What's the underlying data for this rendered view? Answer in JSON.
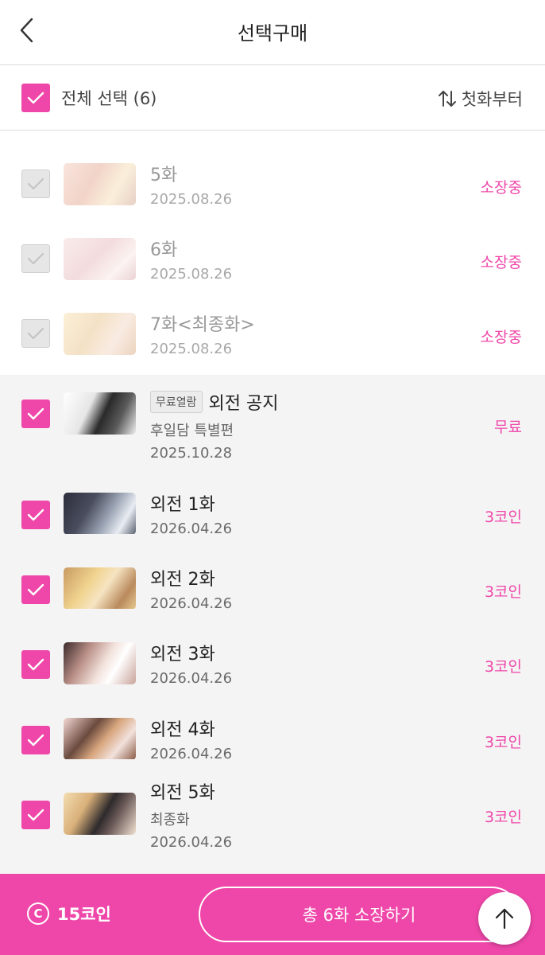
{
  "header": {
    "title": "선택구매"
  },
  "selectbar": {
    "select_all_label": "전체 선택 (6)",
    "sort_label": "첫화부터"
  },
  "episodes": [
    {
      "title": "5화",
      "date": "2025.08.26",
      "status": "소장중"
    },
    {
      "title": "6화",
      "date": "2025.08.26",
      "status": "소장중"
    },
    {
      "title": "7화<최종화>",
      "date": "2025.08.26",
      "status": "소장중"
    },
    {
      "badge": "무료열람",
      "title": "외전 공지",
      "subtitle": "후일담 특별편",
      "date": "2025.10.28",
      "status": "무료"
    },
    {
      "title": "외전 1화",
      "date": "2026.04.26",
      "status": "3코인"
    },
    {
      "title": "외전 2화",
      "date": "2026.04.26",
      "status": "3코인"
    },
    {
      "title": "외전 3화",
      "date": "2026.04.26",
      "status": "3코인"
    },
    {
      "title": "외전 4화",
      "date": "2026.04.26",
      "status": "3코인"
    },
    {
      "title": "외전 5화",
      "subtitle": "최종화",
      "date": "2026.04.26",
      "status": "3코인"
    }
  ],
  "footer": {
    "coin_symbol": "C",
    "coin_balance": "15코인",
    "buy_label": "총 6화 소장하기"
  },
  "colors": {
    "accent": "#ef47a9"
  },
  "icons": {
    "back": "chevron-left-icon",
    "sort": "sort-arrows-icon",
    "check": "check-icon",
    "coin": "coin-icon",
    "scroll_top": "arrow-up-icon"
  }
}
